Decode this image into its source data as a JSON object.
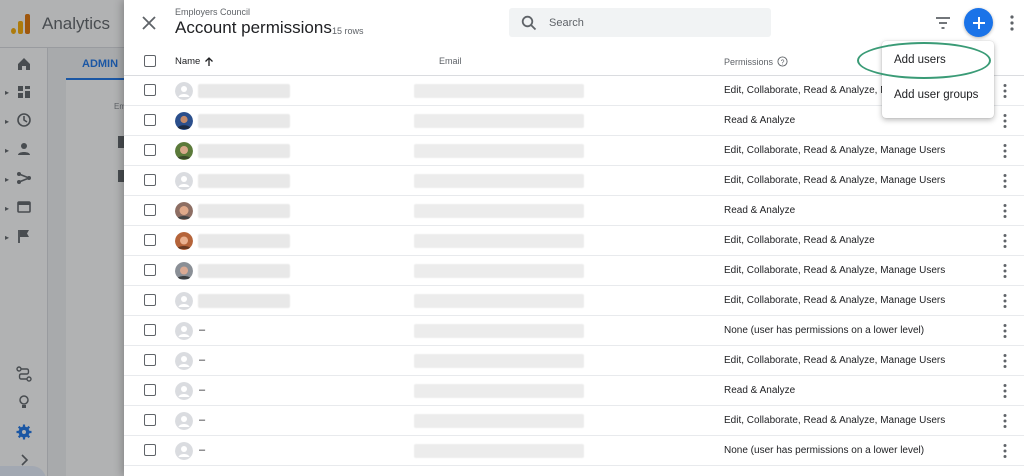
{
  "app": {
    "title": "Analytics",
    "admin_tab": "ADMIN",
    "em_fragment": "Em"
  },
  "sheet": {
    "breadcrumb": "Employers Council",
    "title": "Account permissions",
    "row_count": "15 rows",
    "search_placeholder": "Search"
  },
  "columns": {
    "name": "Name",
    "email": "Email",
    "permissions": "Permissions"
  },
  "dropdown": {
    "add_users": "Add users",
    "add_user_groups": "Add user groups"
  },
  "colors": {
    "accent": "#1a73e8",
    "highlight_ring": "#3a9b76",
    "logo": "#f9ab00"
  },
  "rows": [
    {
      "name": "",
      "avatar": "default",
      "permissions": "Edit, Collaborate, Read & Analyze, Manage Users"
    },
    {
      "name": "",
      "avatar": "photo-blue",
      "permissions": "Read & Analyze"
    },
    {
      "name": "",
      "avatar": "photo-green",
      "permissions": "Edit, Collaborate, Read & Analyze, Manage Users"
    },
    {
      "name": "",
      "avatar": "default",
      "permissions": "Edit, Collaborate, Read & Analyze, Manage Users"
    },
    {
      "name": "",
      "avatar": "photo-face",
      "permissions": "Read & Analyze"
    },
    {
      "name": "",
      "avatar": "photo-orange",
      "permissions": "Edit, Collaborate, Read & Analyze"
    },
    {
      "name": "",
      "avatar": "photo-gray",
      "permissions": "Edit, Collaborate, Read & Analyze, Manage Users"
    },
    {
      "name": "",
      "avatar": "default",
      "permissions": "Edit, Collaborate, Read & Analyze, Manage Users"
    },
    {
      "name": "–",
      "avatar": "default",
      "permissions": "None (user has permissions on a lower level)"
    },
    {
      "name": "–",
      "avatar": "default",
      "permissions": "Edit, Collaborate, Read & Analyze, Manage Users"
    },
    {
      "name": "–",
      "avatar": "default",
      "permissions": "Read & Analyze"
    },
    {
      "name": "–",
      "avatar": "default",
      "permissions": "Edit, Collaborate, Read & Analyze, Manage Users"
    },
    {
      "name": "–",
      "avatar": "default",
      "permissions": "None (user has permissions on a lower level)"
    }
  ]
}
